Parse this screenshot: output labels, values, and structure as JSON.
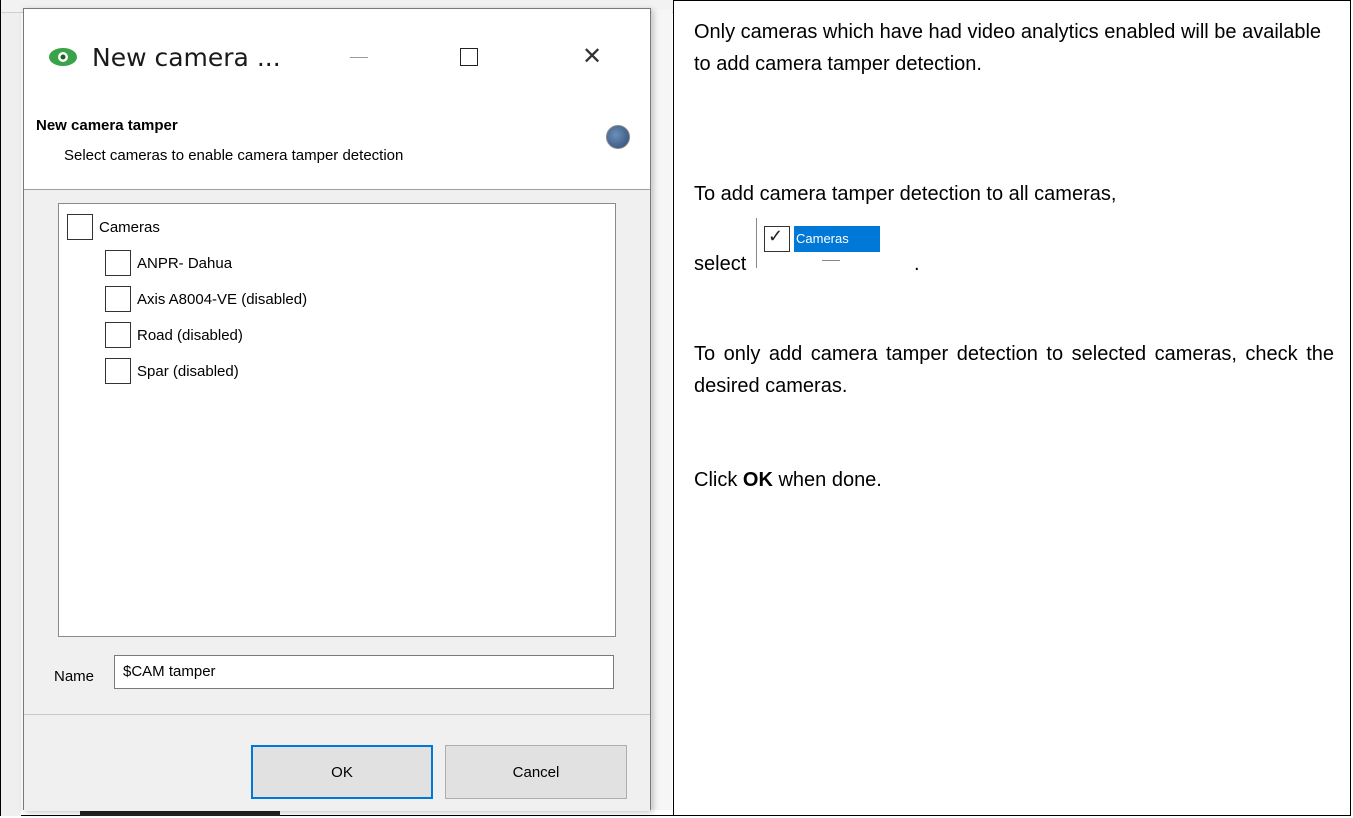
{
  "dialog": {
    "title": "New camera ...",
    "header_title": "New camera tamper",
    "header_subtitle": "Select cameras to enable camera tamper detection",
    "tree": {
      "root_label": "Cameras",
      "items": [
        {
          "label": "ANPR- Dahua"
        },
        {
          "label": "Axis A8004-VE (disabled)"
        },
        {
          "label": "Road (disabled)"
        },
        {
          "label": "Spar (disabled)"
        }
      ]
    },
    "name_label": "Name",
    "name_value": "$CAM tamper",
    "ok_label": "OK",
    "cancel_label": "Cancel"
  },
  "instructions": {
    "p1": "Only cameras which have had video analytics enabled will be available to add camera tamper detection.",
    "p2": "To add camera tamper detection to all cameras,",
    "p2_select": "select",
    "p2_end": ".",
    "inline_cameras_label": "Cameras",
    "p3": "To only add camera tamper detection to selected cameras, check the desired cameras.",
    "p4_prefix": "Click ",
    "p4_bold": "OK",
    "p4_suffix": " when done."
  },
  "colors": {
    "accent": "#0078d7",
    "eye_icon": "#3aa34a"
  }
}
